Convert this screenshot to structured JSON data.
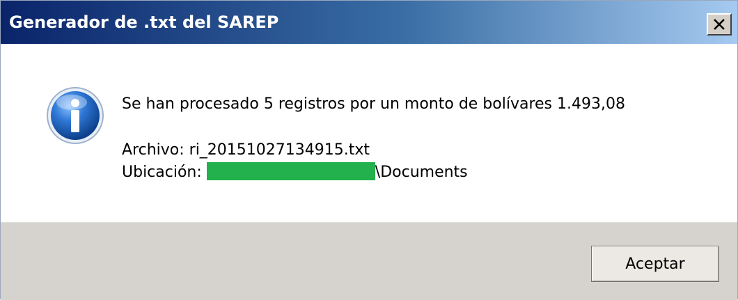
{
  "dialog": {
    "title": "Generador de .txt del SAREP",
    "close_icon": "close-icon",
    "icon": "info-icon",
    "message": "Se han procesado 5 registros por un monto de bolívares 1.493,08",
    "file_line": "Archivo: ri_20151027134915.txt",
    "location_label": "Ubicación:",
    "location_suffix": "\\Documents",
    "ok_label": "Aceptar"
  },
  "colors": {
    "title_gradient_start": "#0a246a",
    "title_gradient_end": "#a6caf0",
    "footer_bg": "#d6d3ce",
    "redaction": "#22b14c",
    "info_icon_blue": "#1e5fb8"
  }
}
